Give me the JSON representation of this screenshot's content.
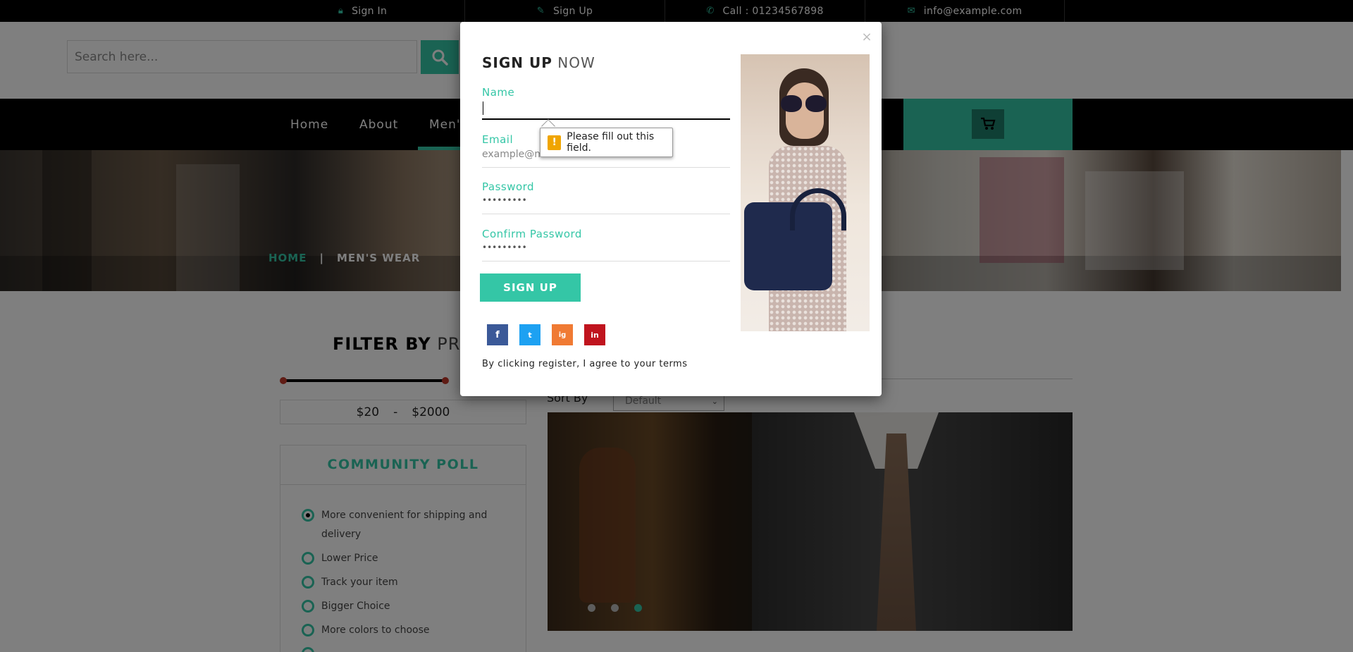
{
  "topbar": {
    "signin": "Sign In",
    "signup": "Sign Up",
    "call": "Call : 01234567898",
    "email": "info@example.com"
  },
  "search": {
    "placeholder": "Search here..."
  },
  "nav": {
    "items": [
      "Home",
      "About",
      "Men's"
    ]
  },
  "breadcrumb": {
    "home": "HOME",
    "separator": "|",
    "current": "MEN'S WEAR"
  },
  "filter": {
    "title_bold": "FILTER BY",
    "title_rest": "PRICE",
    "min": "$20",
    "sep": "-",
    "max": "$2000"
  },
  "poll": {
    "title": "COMMUNITY POLL",
    "options": [
      {
        "label": "More convenient for shipping and delivery",
        "selected": true
      },
      {
        "label": "Lower Price",
        "selected": false
      },
      {
        "label": "Track your item",
        "selected": false
      },
      {
        "label": "Bigger Choice",
        "selected": false
      },
      {
        "label": "More colors to choose",
        "selected": false
      }
    ]
  },
  "sort": {
    "label": "Sort By",
    "value": "Default"
  },
  "carousel": {
    "slides": 3,
    "active": 3
  },
  "modal": {
    "close": "×",
    "title_bold": "SIGN UP",
    "title_rest": "NOW",
    "fields": [
      {
        "label": "Name",
        "value": ""
      },
      {
        "label": "Email",
        "value": "example@mail.com"
      },
      {
        "label": "Password",
        "value": "•••••••••"
      },
      {
        "label": "Confirm Password",
        "value": "•••••••••"
      }
    ],
    "validation": "Please fill out this field.",
    "submit": "SIGN UP",
    "social": [
      "f",
      "t",
      "ig",
      "in"
    ],
    "terms": "By clicking register, I agree to your terms"
  },
  "colors": {
    "accent": "#34c6a6",
    "topbar": "#000000",
    "facebook": "#3b5998",
    "twitter": "#1da1f2",
    "instagram": "#f07a33",
    "linkedin": "#c0141e"
  }
}
